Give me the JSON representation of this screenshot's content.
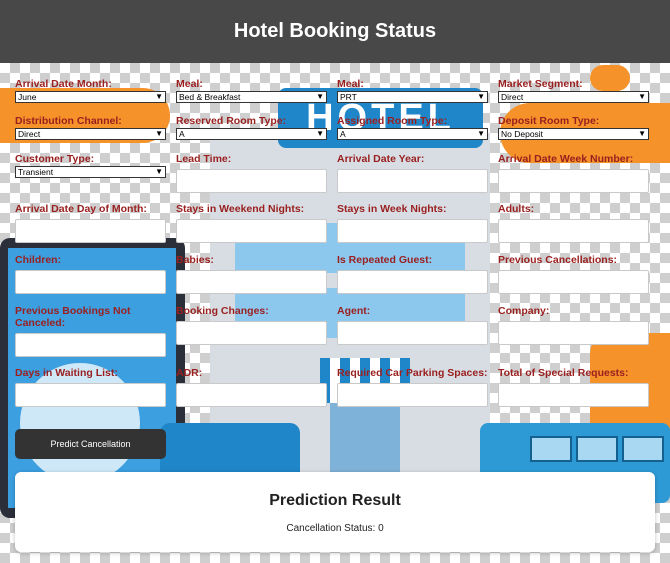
{
  "header": {
    "title": "Hotel Booking Status"
  },
  "background": {
    "sign_text": "HOTEL"
  },
  "form": {
    "arrival_date_month": {
      "label": "Arrival Date Month:",
      "value": "June"
    },
    "meal_1": {
      "label": "Meal:",
      "value": "Bed & Breakfast"
    },
    "meal_2": {
      "label": "Meal:",
      "value": "PRT"
    },
    "market_segment": {
      "label": "Market Segment:",
      "value": "Direct"
    },
    "distribution_channel": {
      "label": "Distribution Channel:",
      "value": "Direct"
    },
    "reserved_room_type": {
      "label": "Reserved Room Type:",
      "value": "A"
    },
    "assigned_room_type": {
      "label": "Assigned Room Type:",
      "value": "A"
    },
    "deposit_room_type": {
      "label": "Deposit Room Type:",
      "value": "No Deposit"
    },
    "customer_type": {
      "label": "Customer Type:",
      "value": "Transient"
    },
    "lead_time": {
      "label": "Lead Time:"
    },
    "arrival_date_year": {
      "label": "Arrival Date Year:"
    },
    "arrival_date_week_number": {
      "label": "Arrival Date Week Number:"
    },
    "arrival_date_day_of_month": {
      "label": "Arrival Date Day of Month:"
    },
    "stays_in_weekend_nights": {
      "label": "Stays in Weekend Nights:"
    },
    "stays_in_week_nights": {
      "label": "Stays in Week Nights:"
    },
    "adults": {
      "label": "Adults:"
    },
    "children": {
      "label": "Children:"
    },
    "babies": {
      "label": "Babies:"
    },
    "is_repeated_guest": {
      "label": "Is Repeated Guest:"
    },
    "previous_cancellations": {
      "label": "Previous Cancellations:"
    },
    "previous_bookings_not_canceled": {
      "label": "Previous Bookings Not Canceled:"
    },
    "booking_changes": {
      "label": "Booking Changes:"
    },
    "agent": {
      "label": "Agent:"
    },
    "company": {
      "label": "Company:"
    },
    "days_in_waiting_list": {
      "label": "Days in Waiting List:"
    },
    "adr": {
      "label": "ADR:"
    },
    "required_car_parking_spaces": {
      "label": "Required Car Parking Spaces:"
    },
    "total_of_special_requests": {
      "label": "Total of Special Requests:"
    }
  },
  "predict_button": {
    "label": "Predict Cancellation"
  },
  "result": {
    "title": "Prediction Result",
    "status": "Cancellation Status: 0"
  },
  "icons": {
    "select_arrow": "chevron-down-icon"
  },
  "colors": {
    "header_bg": "#484848",
    "label": "#9a2020",
    "button_bg": "#333333",
    "accent_orange": "#f5922a",
    "accent_blue": "#1f87c9"
  }
}
